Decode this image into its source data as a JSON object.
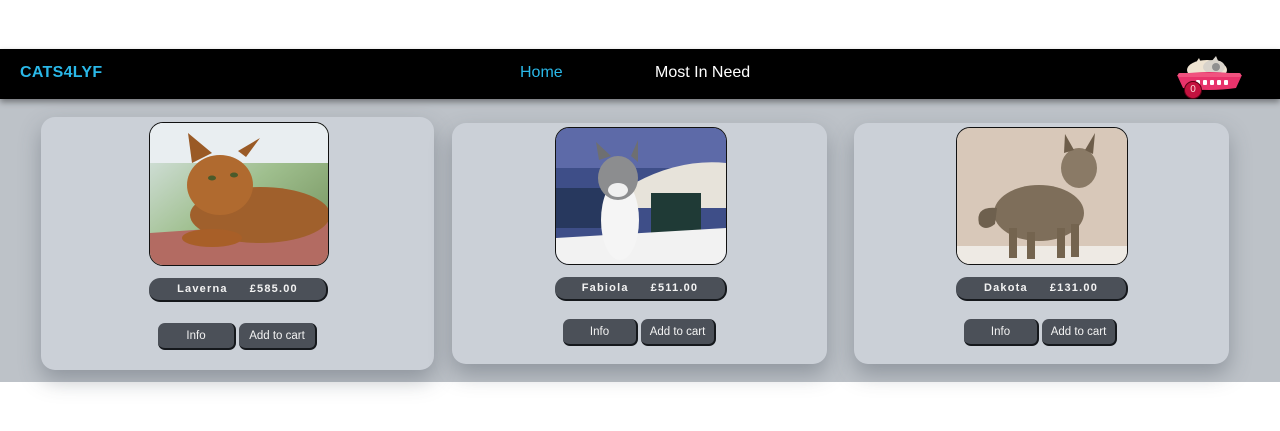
{
  "nav": {
    "brand": "CATS4LYF",
    "links": [
      {
        "label": "Home",
        "active": true
      },
      {
        "label": "Most In Need",
        "active": false
      }
    ],
    "cart_count": "0",
    "cart_icon": "cat-basket-icon"
  },
  "colors": {
    "brand": "#2ab8e8",
    "navbar": "#000000",
    "card": "#cbd0d7",
    "button": "#4b5058"
  },
  "cats": [
    {
      "name": "Laverna",
      "price": "£585.00",
      "info_label": "Info",
      "cart_label": "Add to cart",
      "photo": "abyssinian-cat-photo"
    },
    {
      "name": "Fabiola",
      "price": "£511.00",
      "info_label": "Info",
      "cart_label": "Add to cart",
      "photo": "tabby-white-cat-photo"
    },
    {
      "name": "Dakota",
      "price": "£131.00",
      "info_label": "Info",
      "cart_label": "Add to cart",
      "photo": "tabby-cat-photo"
    }
  ]
}
